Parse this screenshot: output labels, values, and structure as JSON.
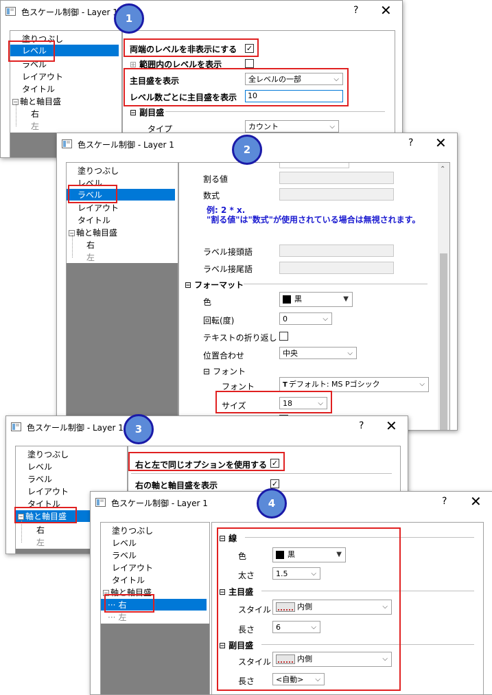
{
  "d1": {
    "title": "色スケール制御 - Layer 1",
    "help": "?",
    "close": "✕",
    "badge": "1",
    "tree": [
      "塗りつぶし",
      "レベル",
      "ラベル",
      "レイアウト",
      "タイトル",
      "軸と軸目盛",
      "右",
      "左"
    ],
    "opt_hide_end": "両端のレベルを非表示にする",
    "opt_show_range": "範囲内のレベルを表示",
    "major_show_label": "主目盛を表示",
    "major_show_value": "全レベルの一部",
    "levels_per_major_label": "レベル数ごとに主目盛を表示",
    "levels_per_major_value": "10",
    "minor_section": "副目盛",
    "type_label": "タイプ",
    "type_value": "カウント"
  },
  "d2": {
    "title": "色スケール制御 - Layer 1",
    "help": "?",
    "close": "✕",
    "badge": "2",
    "tree": [
      "塗りつぶし",
      "レベル",
      "ラベル",
      "レイアウト",
      "タイトル",
      "軸と軸目盛",
      "右",
      "左"
    ],
    "divide_label": "割る値",
    "formula_label": "数式",
    "note": "例: 2 * x.\n\"割る値\"は\"数式\"が使用されている場合は無視されます。",
    "prefix_label": "ラベル接頭語",
    "suffix_label": "ラベル接尾語",
    "format_section": "フォーマット",
    "color_label": "色",
    "color_value": "黒",
    "rotate_label": "回転(度)",
    "rotate_value": "0",
    "wrap_label": "テキストの折り返し",
    "align_label": "位置合わせ",
    "align_value": "中央",
    "font_section": "フォント",
    "font_label": "フォント",
    "font_value": "デフォルト: MS Pゴシック",
    "size_label": "サイズ",
    "size_value": "18"
  },
  "d3": {
    "title": "色スケール制御 - Layer 1",
    "help": "?",
    "close": "✕",
    "badge": "3",
    "tree": [
      "塗りつぶし",
      "レベル",
      "ラベル",
      "レイアウト",
      "タイトル",
      "軸と軸目盛",
      "右",
      "左"
    ],
    "same_option": "右と左で同じオプションを使用する",
    "show_right": "右の軸と軸目盛を表示"
  },
  "d4": {
    "title": "色スケール制御 - Layer 1",
    "help": "?",
    "close": "✕",
    "badge": "4",
    "tree": [
      "塗りつぶし",
      "レベル",
      "ラベル",
      "レイアウト",
      "タイトル",
      "軸と軸目盛",
      "右",
      "左"
    ],
    "line_section": "線",
    "color_label": "色",
    "color_value": "黒",
    "width_label": "太さ",
    "width_value": "1.5",
    "major_section": "主目盛",
    "major_style_label": "スタイル",
    "major_style_value": "内側",
    "major_len_label": "長さ",
    "major_len_value": "6",
    "minor_section": "副目盛",
    "minor_style_label": "スタイル",
    "minor_style_value": "内側",
    "minor_len_label": "長さ",
    "minor_len_value": "<自動>"
  },
  "colors": {
    "highlight": "#e02020",
    "badge_fill": "#5b8ad8",
    "badge_ring": "#1a1aa8",
    "selection": "#0078d7",
    "note": "#1a1ad0"
  }
}
